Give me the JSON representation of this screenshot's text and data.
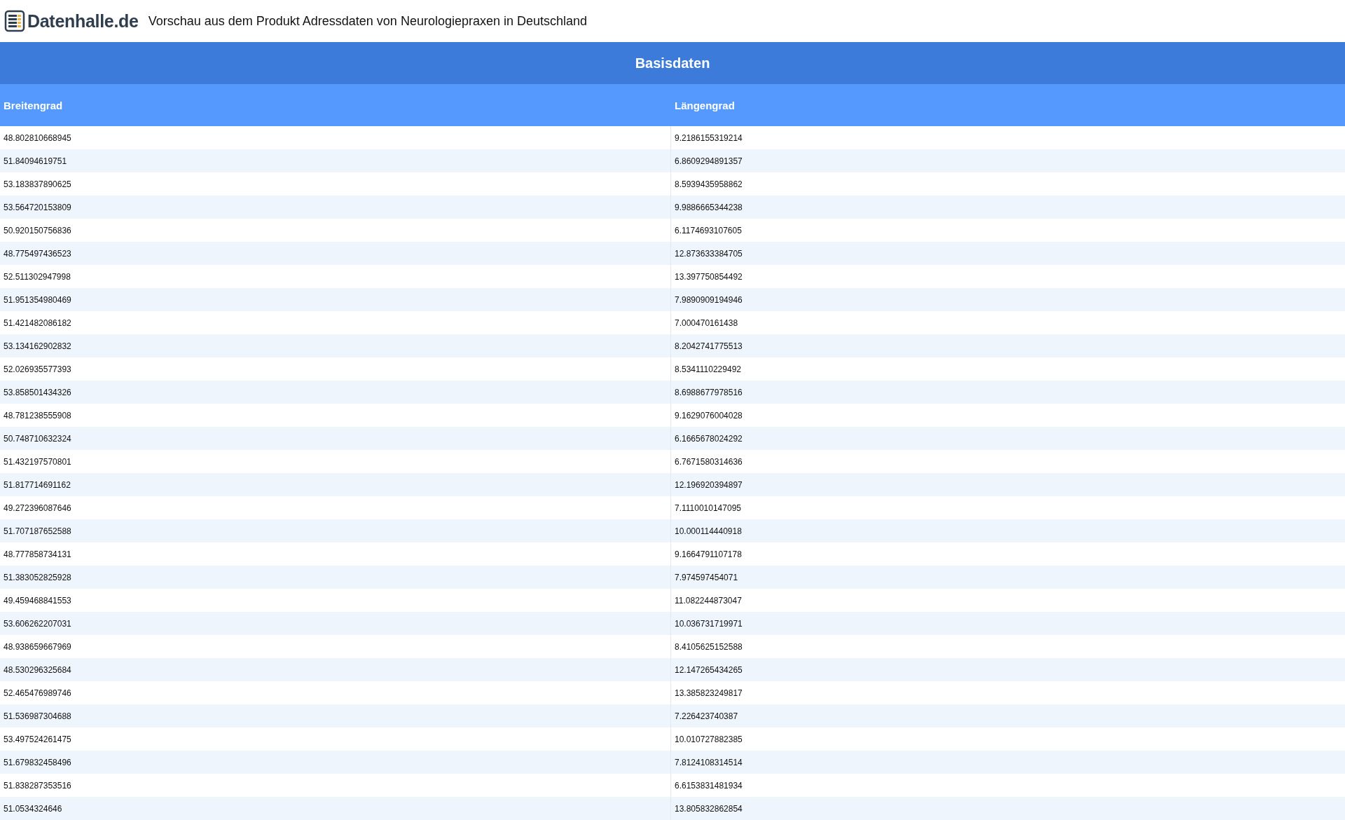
{
  "header": {
    "logo_text": "Datenhalle.de",
    "title": "Vorschau aus dem Produkt Adressdaten von Neurologiepraxen in Deutschland"
  },
  "table": {
    "caption": "Basisdaten",
    "columns": [
      "Breitengrad",
      "Längengrad"
    ],
    "rows": [
      [
        "48.802810668945",
        "9.2186155319214"
      ],
      [
        "51.84094619751",
        "6.8609294891357"
      ],
      [
        "53.183837890625",
        "8.5939435958862"
      ],
      [
        "53.564720153809",
        "9.9886665344238"
      ],
      [
        "50.920150756836",
        "6.1174693107605"
      ],
      [
        "48.775497436523",
        "12.873633384705"
      ],
      [
        "52.511302947998",
        "13.397750854492"
      ],
      [
        "51.951354980469",
        "7.9890909194946"
      ],
      [
        "51.421482086182",
        "7.000470161438"
      ],
      [
        "53.134162902832",
        "8.2042741775513"
      ],
      [
        "52.026935577393",
        "8.5341110229492"
      ],
      [
        "53.858501434326",
        "8.6988677978516"
      ],
      [
        "48.781238555908",
        "9.1629076004028"
      ],
      [
        "50.748710632324",
        "6.1665678024292"
      ],
      [
        "51.432197570801",
        "6.7671580314636"
      ],
      [
        "51.817714691162",
        "12.196920394897"
      ],
      [
        "49.272396087646",
        "7.1110010147095"
      ],
      [
        "51.707187652588",
        "10.000114440918"
      ],
      [
        "48.777858734131",
        "9.1664791107178"
      ],
      [
        "51.383052825928",
        "7.974597454071"
      ],
      [
        "49.459468841553",
        "11.082244873047"
      ],
      [
        "53.606262207031",
        "10.036731719971"
      ],
      [
        "48.938659667969",
        "8.4105625152588"
      ],
      [
        "48.530296325684",
        "12.147265434265"
      ],
      [
        "52.465476989746",
        "13.385823249817"
      ],
      [
        "51.536987304688",
        "7.226423740387"
      ],
      [
        "53.497524261475",
        "10.010727882385"
      ],
      [
        "51.679832458496",
        "7.8124108314514"
      ],
      [
        "51.838287353516",
        "6.6153831481934"
      ],
      [
        "51.0534324646",
        "13.805832862854"
      ]
    ]
  }
}
